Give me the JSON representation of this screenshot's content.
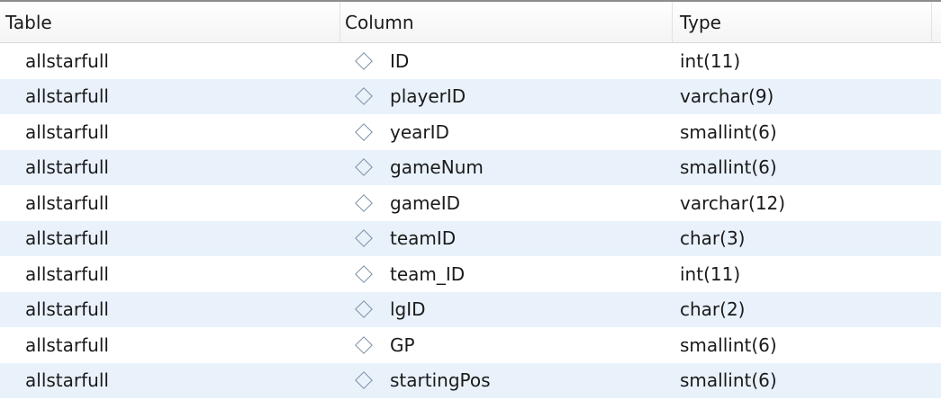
{
  "header": {
    "table": "Table",
    "column": "Column",
    "type": "Type"
  },
  "rows": [
    {
      "table": "allstarfull",
      "column": "ID",
      "type": "int(11)"
    },
    {
      "table": "allstarfull",
      "column": "playerID",
      "type": "varchar(9)"
    },
    {
      "table": "allstarfull",
      "column": "yearID",
      "type": "smallint(6)"
    },
    {
      "table": "allstarfull",
      "column": "gameNum",
      "type": "smallint(6)"
    },
    {
      "table": "allstarfull",
      "column": "gameID",
      "type": "varchar(12)"
    },
    {
      "table": "allstarfull",
      "column": "teamID",
      "type": "char(3)"
    },
    {
      "table": "allstarfull",
      "column": "team_ID",
      "type": "int(11)"
    },
    {
      "table": "allstarfull",
      "column": "lgID",
      "type": "char(2)"
    },
    {
      "table": "allstarfull",
      "column": "GP",
      "type": "smallint(6)"
    },
    {
      "table": "allstarfull",
      "column": "startingPos",
      "type": "smallint(6)"
    }
  ],
  "icons": {
    "column": "column-diamond-icon"
  },
  "colors": {
    "alt_row": "#e9f2fb",
    "icon_stroke": "#7a8ea6"
  }
}
